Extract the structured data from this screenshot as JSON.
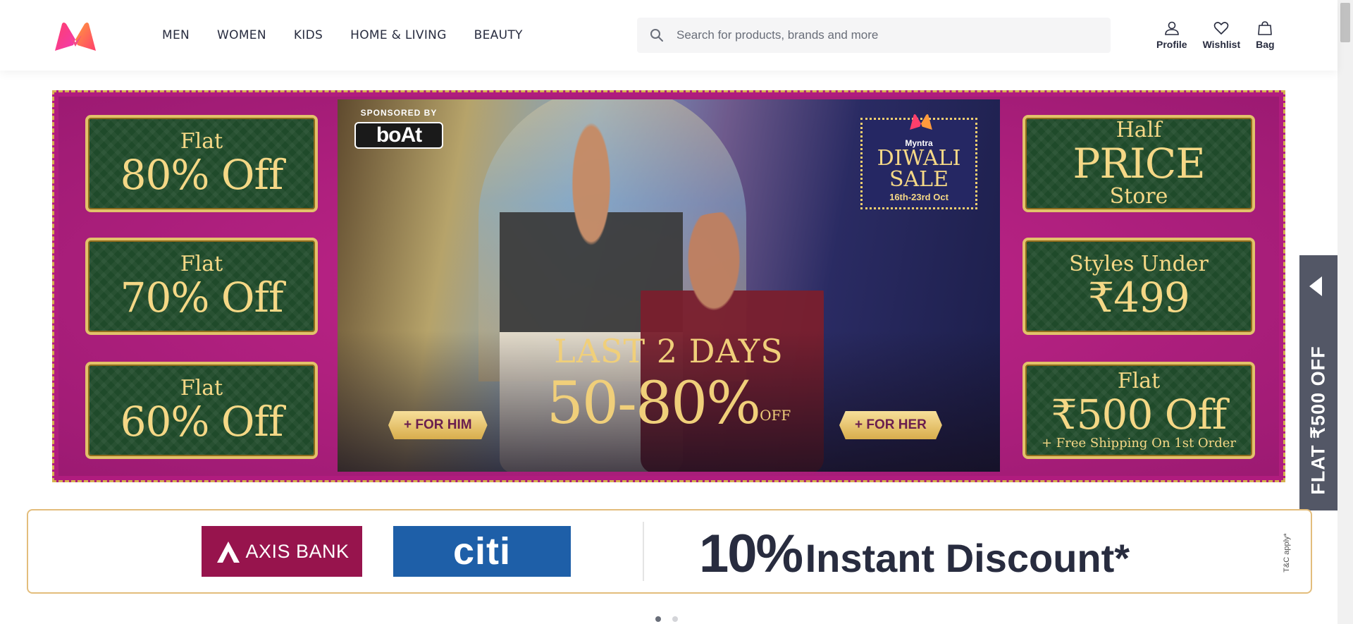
{
  "header": {
    "nav": [
      "MEN",
      "WOMEN",
      "KIDS",
      "HOME & LIVING",
      "BEAUTY"
    ],
    "search": {
      "placeholder": "Search for products, brands and more",
      "icon": "search-icon"
    },
    "actions": [
      {
        "label": "Profile",
        "icon": "person-icon"
      },
      {
        "label": "Wishlist",
        "icon": "heart-icon"
      },
      {
        "label": "Bag",
        "icon": "bag-icon"
      }
    ]
  },
  "banner": {
    "left_offers": [
      {
        "line1": "Flat",
        "line2": "80% Off"
      },
      {
        "line1": "Flat",
        "line2": "70% Off"
      },
      {
        "line1": "Flat",
        "line2": "60% Off"
      }
    ],
    "right_offers": [
      {
        "line1": "Half",
        "line2": "PRICE",
        "line3": "Store"
      },
      {
        "line1": "Styles Under",
        "line2": "₹499"
      },
      {
        "line1": "Flat",
        "line2": "₹500 Off",
        "line3": "+ Free Shipping On 1st Order"
      }
    ],
    "sponsor_label": "SPONSORED BY",
    "sponsor_name": "boAt",
    "sale_brand": "Myntra",
    "sale_title_1": "DIWALI",
    "sale_title_2": "SALE",
    "sale_dates": "16th-23rd Oct",
    "headline": "LAST 2 DAYS",
    "discount_range": "50-80%",
    "discount_suffix": "OFF",
    "cta_him": "+ FOR HIM",
    "cta_her": "+ FOR HER"
  },
  "side_tab": {
    "label": "FLAT ₹500 OFF"
  },
  "bank_strip": {
    "bank1": "AXIS BANK",
    "bank2": "citi",
    "offer_pct": "10%",
    "offer_text": "Instant Discount*",
    "tnc": "T&C apply*"
  },
  "colors": {
    "brand_pink": "#ff3f6c",
    "banner_magenta": "#b01c7e",
    "offer_green": "#1f4a2a",
    "gold": "#e2c26a",
    "axis_maroon": "#97144d",
    "citi_blue": "#1e5fa8",
    "side_tab_gray": "#535766"
  },
  "carousel": {
    "dots": 2,
    "active": 1
  }
}
